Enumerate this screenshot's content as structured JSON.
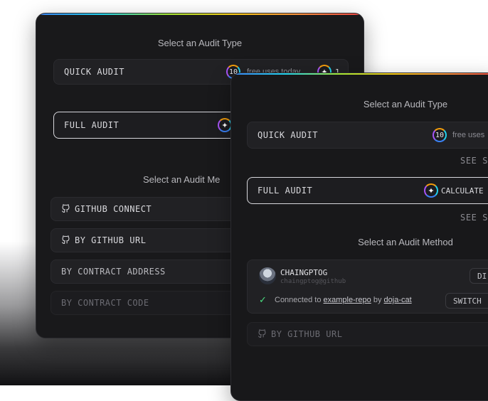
{
  "back": {
    "audit_type_heading": "Select an Audit Type",
    "quick_audit_label": "QUICK AUDIT",
    "quick_credits": "10",
    "free_uses_text": "free uses today",
    "free_uses_count": "1",
    "full_audit_label": "FULL AUDIT",
    "audit_method_heading": "Select an Audit Me",
    "methods": [
      {
        "label": "GITHUB CONNECT"
      },
      {
        "label": "BY GITHUB URL"
      },
      {
        "label": "BY CONTRACT ADDRESS"
      },
      {
        "label": "BY CONTRACT CODE"
      }
    ]
  },
  "front": {
    "audit_type_heading": "Select an Audit Type",
    "quick_audit_label": "QUICK AUDIT",
    "quick_credits": "10",
    "free_uses_text": "free uses",
    "see_sample_1": "SEE S",
    "full_audit_label": "FULL AUDIT",
    "full_audit_status": "CALCULATE",
    "see_sample_2": "SEE S",
    "audit_method_heading": "Select an Audit Method",
    "account": {
      "name": "CHAINGPTOG",
      "handle": "chaingptog@github",
      "disconnect_label": "DI",
      "connected_prefix": "Connected to",
      "repo": "example-repo",
      "by": "by",
      "owner": "doja-cat",
      "switch_label": "SWITCH"
    },
    "next_method_label": "BY GITHUB URL"
  },
  "colors": {
    "card_bg": "#19191b",
    "accent_gradient": [
      "#3b82f6",
      "#22d3ee",
      "#a3e635",
      "#facc15",
      "#fb923c",
      "#ef4444"
    ],
    "check_green": "#4ade80"
  },
  "icons": {
    "github": "github-icon",
    "sparkle": "sparkle-icon",
    "check": "check-icon",
    "avatar": "avatar"
  }
}
